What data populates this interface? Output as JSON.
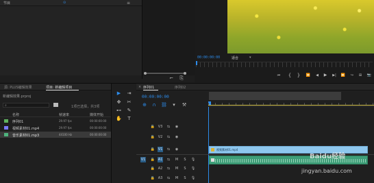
{
  "source_monitor": {
    "title": "节目",
    "timecode": "00:00:00:00"
  },
  "program_monitor": {
    "timecode": "00:00:00:00",
    "fit_label": "适合",
    "transport": [
      "⏮",
      "{",
      "}",
      "⏪",
      "◀",
      "▶",
      "▶|",
      "⏩",
      "↪",
      "⊞",
      "📷"
    ]
  },
  "project_panel": {
    "tabs": [
      "源: PLUS编辑效果",
      "项目: 新编辑项目"
    ],
    "file_name": "新编辑效果.prproj",
    "selection_info": "1项已选择，共3项",
    "columns": [
      "名称",
      "帧速率",
      "媒体开始"
    ],
    "items": [
      {
        "name": "序列01",
        "fps": "29.97 fps",
        "start": "00:00:00:00"
      },
      {
        "name": "视频素材01.mp4",
        "fps": "29.97 fps",
        "start": "00:00:00:00"
      },
      {
        "name": "音乐素材01.mp3",
        "fps": "44100 Hz",
        "start": "00:00:00:00"
      }
    ]
  },
  "tools": [
    "▶",
    "⇥",
    "✥",
    "⊷",
    "✎",
    "✋",
    "T"
  ],
  "timeline": {
    "tabs": [
      "序列01",
      "序列02"
    ],
    "timecode": "00:00:00:00",
    "video_tracks": [
      "V3",
      "V2",
      "V1"
    ],
    "audio_tracks": [
      "A1",
      "A2",
      "A3"
    ],
    "video_clip": "视频素材01.mp4",
    "source_label": "V1"
  },
  "watermark": {
    "brand": "Baidu经验",
    "url": "jingyan.baidu.com"
  },
  "colors": {
    "accent": "#2d8ceb",
    "video_clip": "#8ec7ee",
    "audio_clip": "#3e9e78",
    "yellow_line": "#d3c24c"
  }
}
